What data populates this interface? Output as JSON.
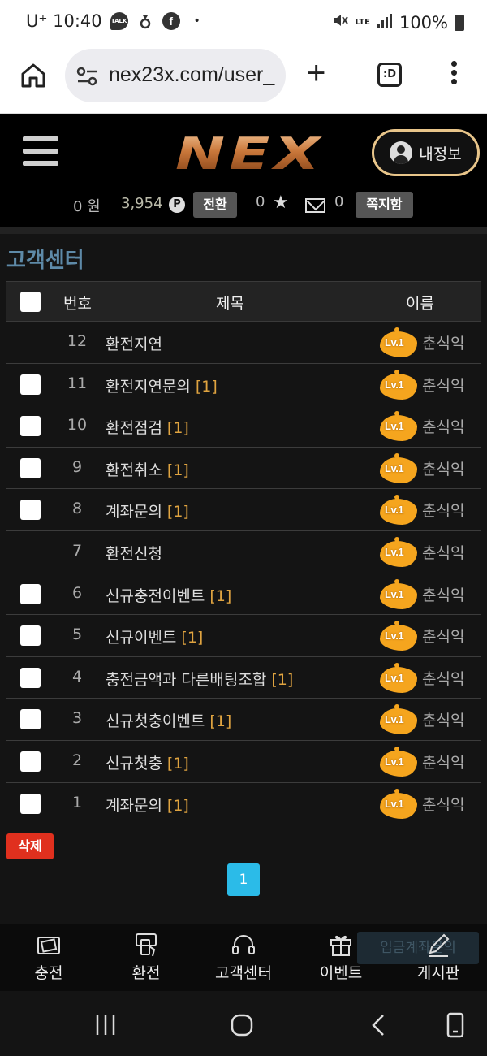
{
  "status_bar": {
    "carrier_time": "U⁺ 10:40",
    "talk_icon": "talk-icon",
    "network": "LTE",
    "battery": "100%"
  },
  "browser": {
    "url": "nex23x.com/user_",
    "tab_label": ":D"
  },
  "header": {
    "logo": "NEX",
    "profile_label": "내정보"
  },
  "wallet": {
    "won": "0 원",
    "points": "3,954",
    "point_icon": "P",
    "convert_label": "전환",
    "stars": "0",
    "messages": "0",
    "note_label": "쪽지함"
  },
  "board": {
    "title": "고객센터",
    "columns": {
      "num": "번호",
      "title": "제목",
      "name": "이름"
    },
    "level_badge": "Lv.1",
    "rows": [
      {
        "num": "12",
        "title": "환전지연",
        "count": "",
        "name": "춘식익",
        "checkbox": false
      },
      {
        "num": "11",
        "title": "환전지연문의",
        "count": "[1]",
        "name": "춘식익",
        "checkbox": true
      },
      {
        "num": "10",
        "title": "환전점검",
        "count": "[1]",
        "name": "춘식익",
        "checkbox": true
      },
      {
        "num": "9",
        "title": "환전취소",
        "count": "[1]",
        "name": "춘식익",
        "checkbox": true
      },
      {
        "num": "8",
        "title": "계좌문의",
        "count": "[1]",
        "name": "춘식익",
        "checkbox": true
      },
      {
        "num": "7",
        "title": "환전신청",
        "count": "",
        "name": "춘식익",
        "checkbox": false
      },
      {
        "num": "6",
        "title": "신규충전이벤트",
        "count": "[1]",
        "name": "춘식익",
        "checkbox": true
      },
      {
        "num": "5",
        "title": "신규이벤트",
        "count": "[1]",
        "name": "춘식익",
        "checkbox": true
      },
      {
        "num": "4",
        "title": "충전금액과 다른배팅조합",
        "count": "[1]",
        "name": "춘식익",
        "checkbox": true
      },
      {
        "num": "3",
        "title": "신규첫충이벤트",
        "count": "[1]",
        "name": "춘식익",
        "checkbox": true
      },
      {
        "num": "2",
        "title": "신규첫충",
        "count": "[1]",
        "name": "춘식익",
        "checkbox": true
      },
      {
        "num": "1",
        "title": "계좌문의",
        "count": "[1]",
        "name": "춘식익",
        "checkbox": true
      }
    ],
    "delete_label": "삭제",
    "current_page": "1"
  },
  "bottom_nav": {
    "overlay_text": "입금계좌문의",
    "items": [
      {
        "label": "충전",
        "icon": "wallet-icon"
      },
      {
        "label": "환전",
        "icon": "exchange-icon"
      },
      {
        "label": "고객센터",
        "icon": "headset-icon"
      },
      {
        "label": "이벤트",
        "icon": "gift-icon"
      },
      {
        "label": "게시판",
        "icon": "pencil-icon"
      }
    ]
  },
  "colors": {
    "accent_gold": "#e8c58a",
    "title_blue": "#5e8aa8",
    "delete_red": "#e0301e",
    "page_cyan": "#2bbbe8",
    "level_orange": "#f5a51e"
  }
}
